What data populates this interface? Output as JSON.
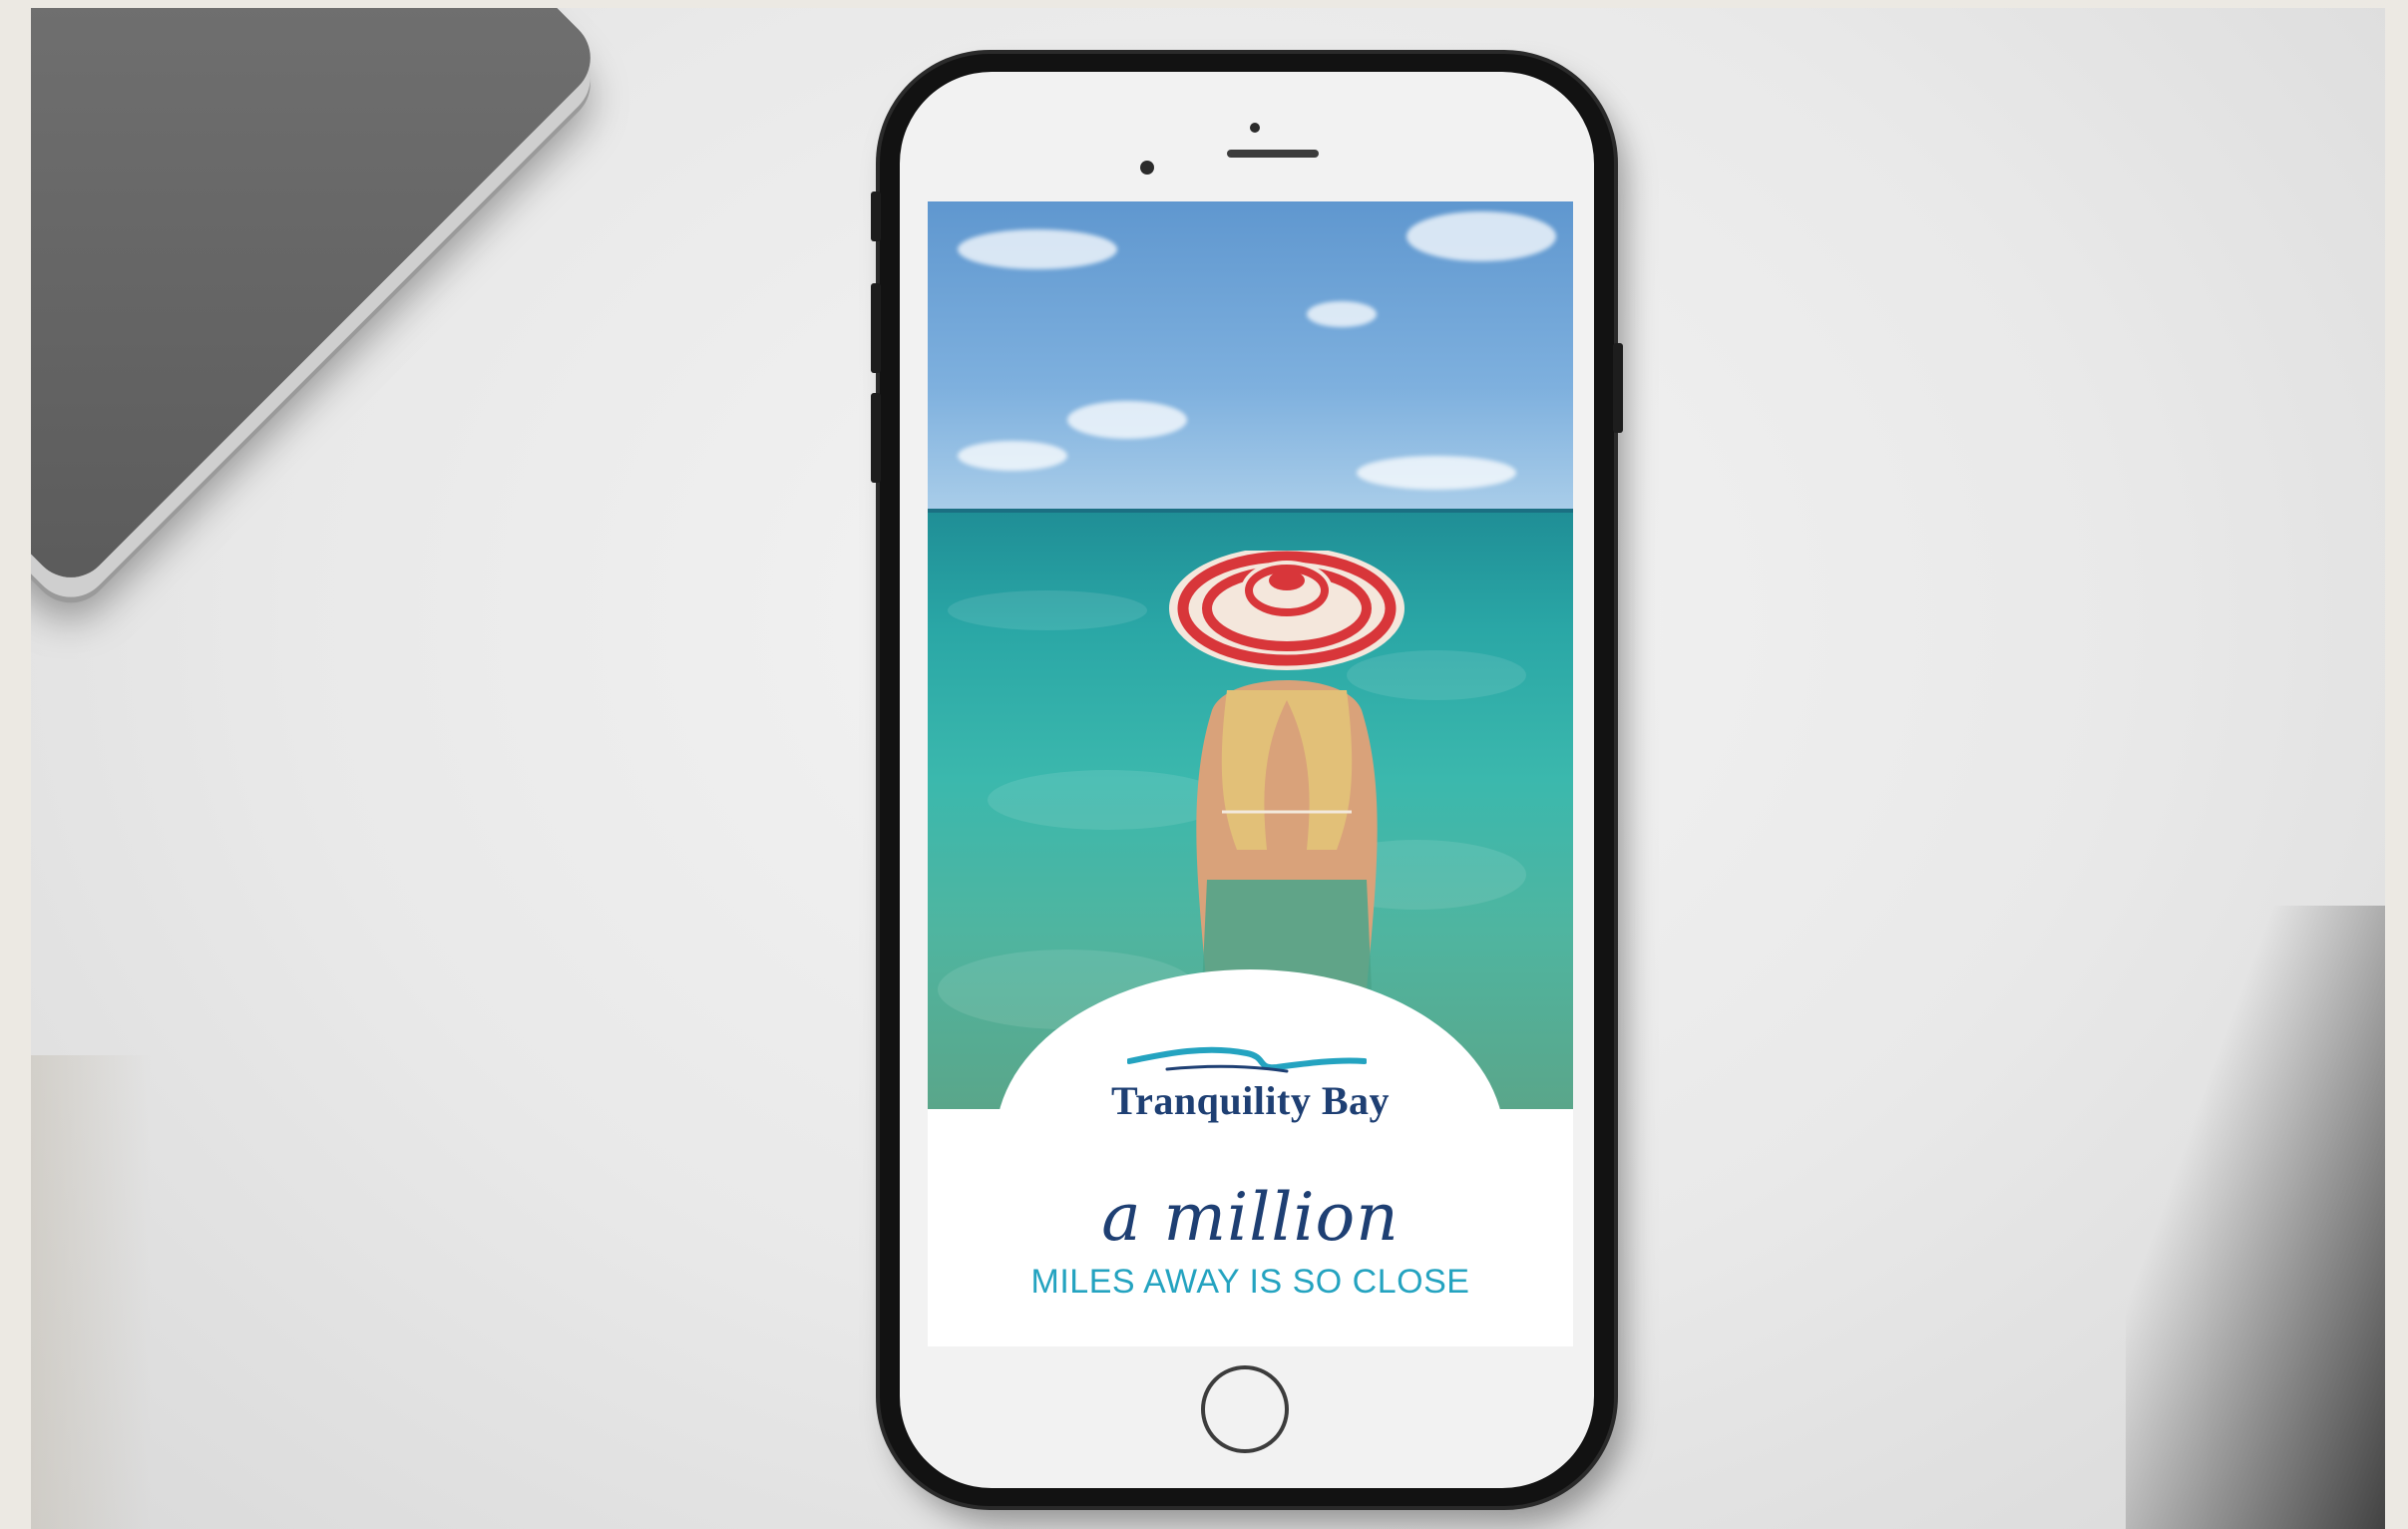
{
  "ad": {
    "brand_name": "Tranquility Bay",
    "tagline_main": "a million",
    "tagline_sub": "MILES AWAY IS SO CLOSE"
  },
  "colors": {
    "brand_navy": "#1e3f73",
    "brand_teal": "#24a3c0",
    "sea": "#2aa7a6",
    "sky": "#6ea3d6",
    "hat_red": "#d8363a"
  },
  "icons": {
    "logo_mark": "wave-icon",
    "home_button": "home-button-icon"
  }
}
